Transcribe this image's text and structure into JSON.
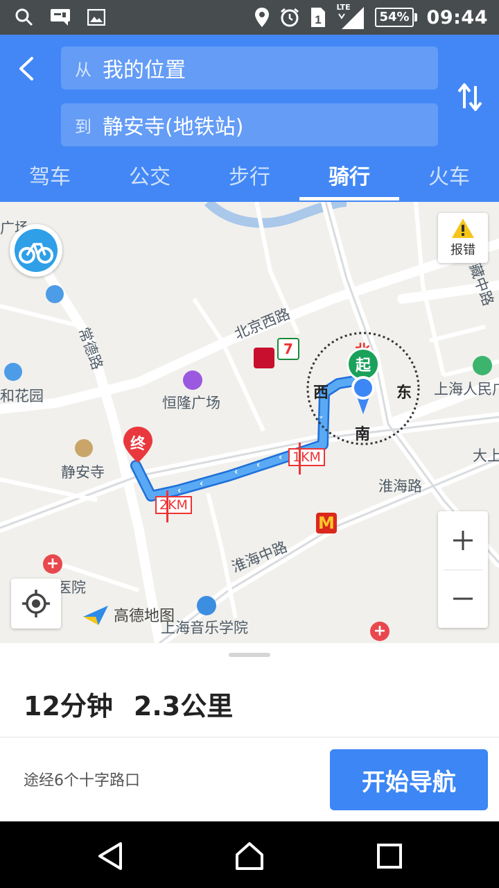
{
  "status_bar": {
    "battery": "54%",
    "time": "09:44",
    "network": "LTE"
  },
  "route": {
    "from_prefix": "从",
    "from_value": "我的位置",
    "to_prefix": "到",
    "to_value": "静安寺(地铁站)"
  },
  "tabs": [
    {
      "label": "驾车"
    },
    {
      "label": "公交"
    },
    {
      "label": "步行"
    },
    {
      "label": "骑行"
    },
    {
      "label": "火车"
    }
  ],
  "map": {
    "report_label": "报错",
    "end_marker": "终",
    "start_marker": "起",
    "km_markers": [
      "1KM",
      "2KM"
    ],
    "compass": {
      "north": "北",
      "east": "东",
      "south": "南",
      "west": "西"
    },
    "logo_text": "高德地图",
    "labels": [
      "北京西路",
      "恒隆广场",
      "静安寺",
      "淮海路",
      "淮海中路",
      "上海音乐学院",
      "上海人民广",
      "和花园",
      "大上",
      "常德路",
      "广场",
      "医院",
      "藏中路"
    ]
  },
  "summary": {
    "duration": "12分钟",
    "distance": "2.3公里"
  },
  "via": "途经6个十字路口",
  "start_nav_label": "开始导航"
}
